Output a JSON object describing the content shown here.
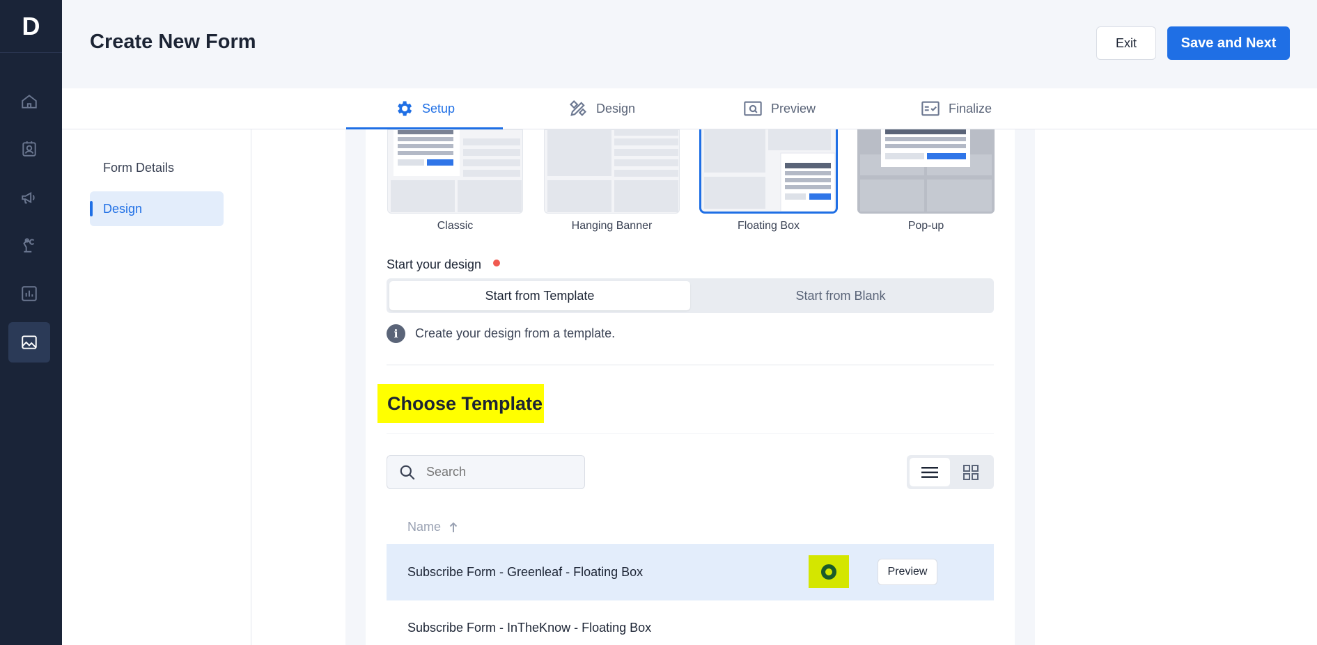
{
  "app": {
    "logo_letter": "D"
  },
  "sidebar": {
    "items": [
      {
        "icon": "home-icon"
      },
      {
        "icon": "contacts-icon"
      },
      {
        "icon": "megaphone-icon"
      },
      {
        "icon": "automation-icon"
      },
      {
        "icon": "chart-icon"
      },
      {
        "icon": "image-icon",
        "active": true
      }
    ]
  },
  "header": {
    "title": "Create New Form",
    "exit_label": "Exit",
    "save_label": "Save and Next"
  },
  "tabs": [
    {
      "label": "Setup",
      "icon": "gear-icon",
      "active": true
    },
    {
      "label": "Design",
      "icon": "pencil-ruler-icon"
    },
    {
      "label": "Preview",
      "icon": "preview-icon"
    },
    {
      "label": "Finalize",
      "icon": "checklist-icon"
    }
  ],
  "submenu": {
    "items": [
      {
        "label": "Form Details"
      },
      {
        "label": "Design",
        "active": true
      }
    ]
  },
  "form_types": [
    {
      "label": "Classic"
    },
    {
      "label": "Hanging Banner"
    },
    {
      "label": "Floating Box",
      "selected": true
    },
    {
      "label": "Pop-up"
    }
  ],
  "start_design": {
    "label": "Start your design",
    "options": [
      "Start from Template",
      "Start from Blank"
    ],
    "selected": "Start from Template",
    "info": "Create your design from a template."
  },
  "templates": {
    "title": "Choose Template",
    "search_placeholder": "Search",
    "column_name": "Name",
    "sort_icon": "arrow-up-icon",
    "rows": [
      {
        "name": "Subscribe Form - Greenleaf - Floating Box",
        "selected": true,
        "preview_label": "Preview"
      },
      {
        "name": "Subscribe Form - InTheKnow - Floating Box"
      }
    ]
  },
  "colors": {
    "accent": "#1f6fe5",
    "sidebar_bg": "#1a2438",
    "highlight": "#ffff00"
  }
}
